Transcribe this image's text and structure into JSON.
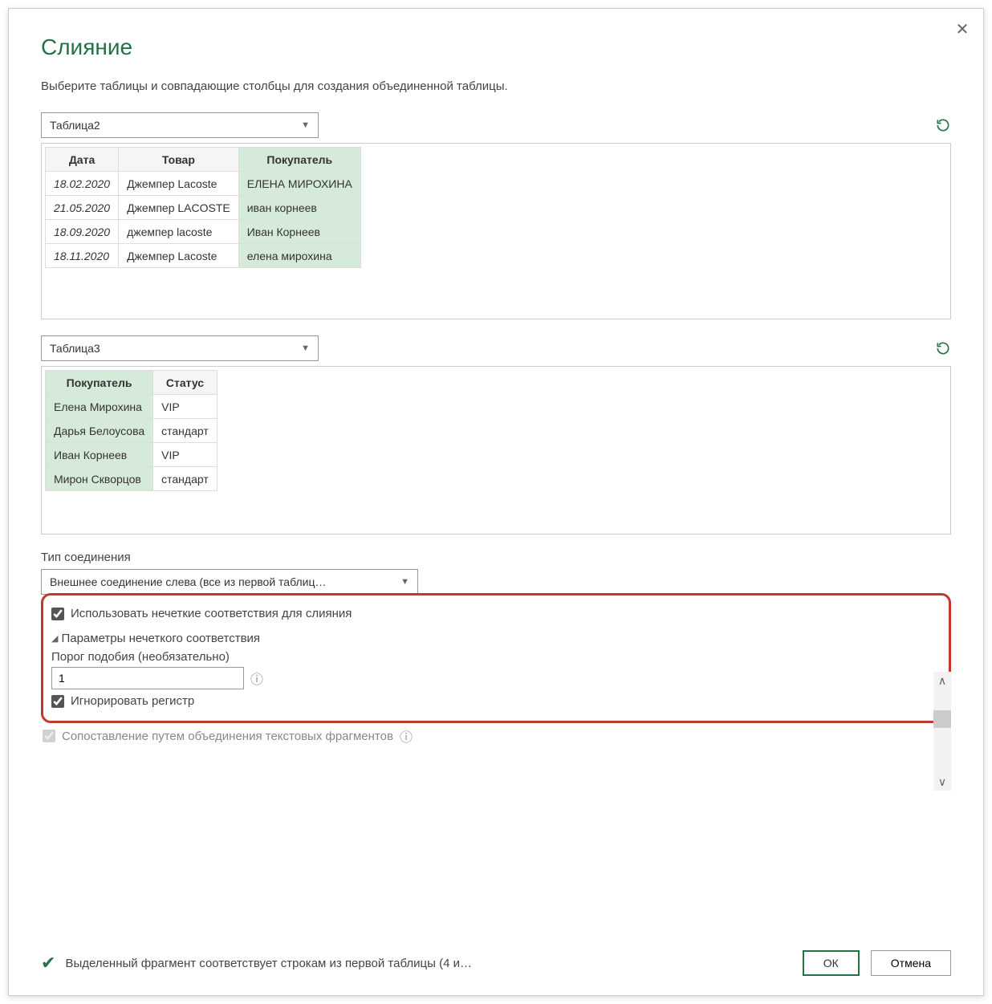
{
  "dialog": {
    "title": "Слияние",
    "subtitle": "Выберите таблицы и совпадающие столбцы для создания объединенной таблицы."
  },
  "table1": {
    "selected": "Таблица2",
    "headers": [
      "Дата",
      "Товар",
      "Покупатель"
    ],
    "selected_col": 2,
    "rows": [
      [
        "18.02.2020",
        "Джемпер Lacoste",
        "ЕЛЕНА МИРОХИНА"
      ],
      [
        "21.05.2020",
        "Джемпер LACOSTE",
        "иван корнеев"
      ],
      [
        "18.09.2020",
        "джемпер lacoste",
        "Иван Корнеев"
      ],
      [
        "18.11.2020",
        "Джемпер Lacoste",
        "елена мирохина"
      ]
    ]
  },
  "table2": {
    "selected": "Таблица3",
    "headers": [
      "Покупатель",
      "Статус"
    ],
    "selected_col": 0,
    "rows": [
      [
        "Елена Мирохина",
        "VIP"
      ],
      [
        "Дарья Белоусова",
        "стандарт"
      ],
      [
        "Иван Корнеев",
        "VIP"
      ],
      [
        "Мирон Скворцов",
        "стандарт"
      ]
    ]
  },
  "join": {
    "label": "Тип соединения",
    "value": "Внешнее соединение слева (все из первой таблиц…"
  },
  "fuzzy": {
    "use_fuzzy": "Использовать нечеткие соответствия для слияния",
    "params_header": "Параметры нечеткого соответствия",
    "threshold_label": "Порог подобия (необязательно)",
    "threshold_value": "1",
    "ignore_case": "Игнорировать регистр",
    "cutoff_text": "Сопоставление путем объединения текстовых фрагментов"
  },
  "status": "Выделенный фрагмент соответствует строкам из первой таблицы (4 и…",
  "buttons": {
    "ok": "ОК",
    "cancel": "Отмена"
  }
}
